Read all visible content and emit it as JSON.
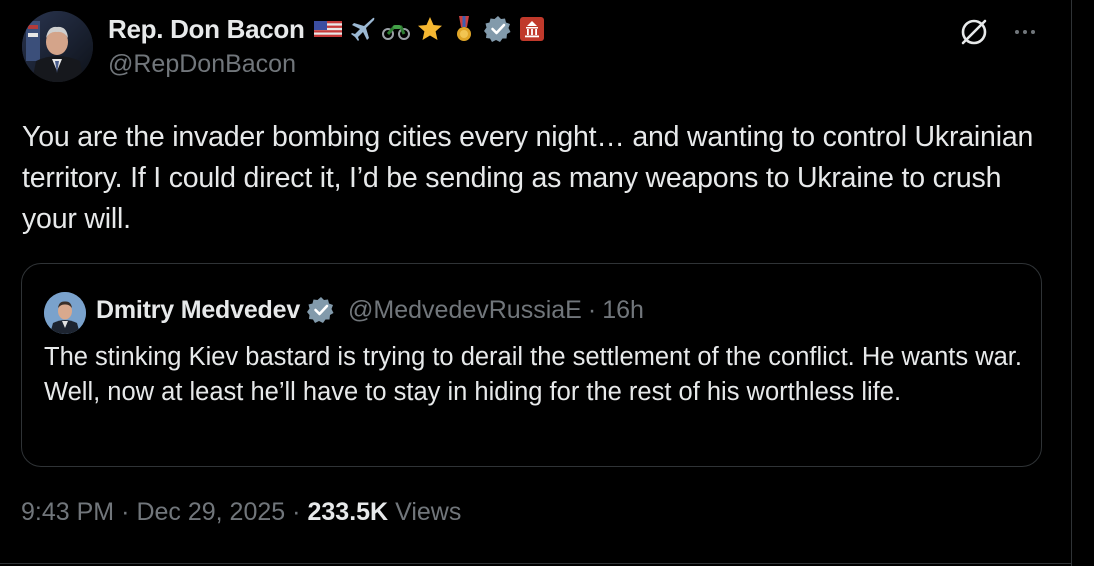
{
  "author": {
    "display_name": "Rep. Don Bacon",
    "handle": "@RepDonBacon",
    "badges": [
      "us-flag-icon",
      "airplane-icon",
      "motorcycle-icon",
      "star-icon",
      "medal-icon",
      "verified-badge-icon",
      "government-building-icon"
    ]
  },
  "tweet": {
    "text": "You are the invader bombing cities every night… and wanting to control Ukrainian territory. If I could direct it, I’d be sending as many weapons to Ukraine to crush your will."
  },
  "quoted": {
    "display_name": "Dmitry Medvedev",
    "handle": "@MedvedevRussiaE",
    "separator": "·",
    "time": "16h",
    "text": "The stinking Kiev bastard is trying to derail the settlement of the conflict. He wants war. Well, now at least he’ll have to stay in hiding for the rest of his worthless life."
  },
  "meta": {
    "time": "9:43 PM",
    "date": "Dec 29, 2025",
    "separator": "·",
    "views_count": "233.5K",
    "views_label": "Views"
  },
  "colors": {
    "background": "#000000",
    "text_primary": "#e7e9ea",
    "text_secondary": "#71767b",
    "border": "#2f3336",
    "verified_gray": "#829aab"
  }
}
